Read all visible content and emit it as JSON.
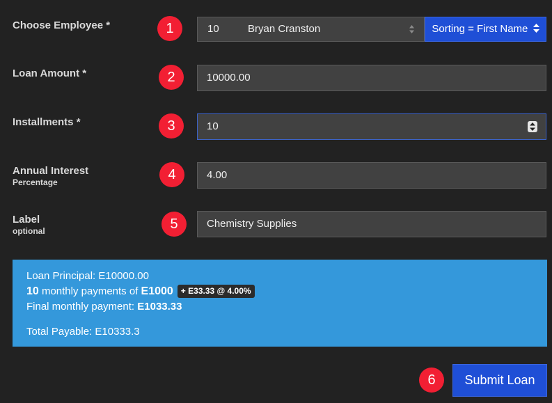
{
  "form": {
    "employee": {
      "label": "Choose Employee *",
      "badge": "1",
      "selected_id": "10",
      "selected_name": "Bryan Cranston",
      "sort_button": "Sorting = First Name"
    },
    "loan_amount": {
      "label": "Loan Amount *",
      "badge": "2",
      "value": "10000.00"
    },
    "installments": {
      "label": "Installments *",
      "badge": "3",
      "value": "10"
    },
    "interest": {
      "label": "Annual Interest",
      "sublabel": "Percentage",
      "badge": "4",
      "value": "4.00"
    },
    "note": {
      "label": "Label",
      "sublabel": "optional",
      "badge": "5",
      "value": "Chemistry Supplies"
    }
  },
  "summary": {
    "principal": "Loan Principal: E10000.00",
    "payments_count": "10",
    "payments_text": " monthly payments of ",
    "payment_amount": "E1000",
    "interest_pill": "+ E33.33 @ 4.00%",
    "final_text": "Final monthly payment: ",
    "final_amount": "E1033.33",
    "total": "Total Payable: E10333.3"
  },
  "submit": {
    "badge": "6",
    "label": "Submit Loan"
  },
  "colors": {
    "background": "#222222",
    "badge": "#f21f33",
    "primary_button": "#1f4fd6",
    "summary_panel": "#3498db"
  }
}
